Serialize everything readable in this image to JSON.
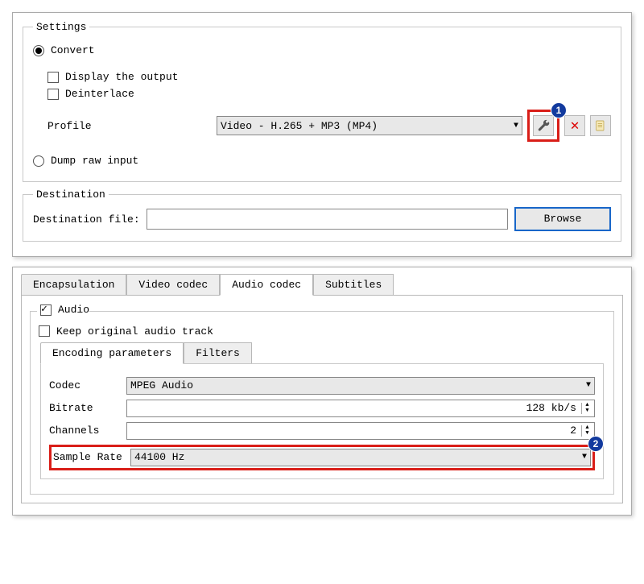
{
  "settings": {
    "legend": "Settings",
    "convert_label": "Convert",
    "display_output_label": "Display the output",
    "deinterlace_label": "Deinterlace",
    "profile_label": "Profile",
    "profile_value": "Video - H.265 + MP3 (MP4)",
    "dump_label": "Dump raw input"
  },
  "destination": {
    "legend": "Destination",
    "file_label": "Destination file:",
    "file_value": "",
    "browse_label": "Browse"
  },
  "codec_tabs": {
    "encapsulation": "Encapsulation",
    "video_codec": "Video codec",
    "audio_codec": "Audio codec",
    "subtitles": "Subtitles"
  },
  "audio": {
    "audio_label": "Audio",
    "keep_original_label": "Keep original audio track",
    "sub_tabs": {
      "encoding": "Encoding parameters",
      "filters": "Filters"
    },
    "params": {
      "codec_label": "Codec",
      "codec_value": "MPEG Audio",
      "bitrate_label": "Bitrate",
      "bitrate_value": "128 kb/s",
      "channels_label": "Channels",
      "channels_value": "2",
      "samplerate_label": "Sample Rate",
      "samplerate_value": "44100 Hz"
    }
  },
  "annotations": {
    "badge1": "1",
    "badge2": "2"
  }
}
